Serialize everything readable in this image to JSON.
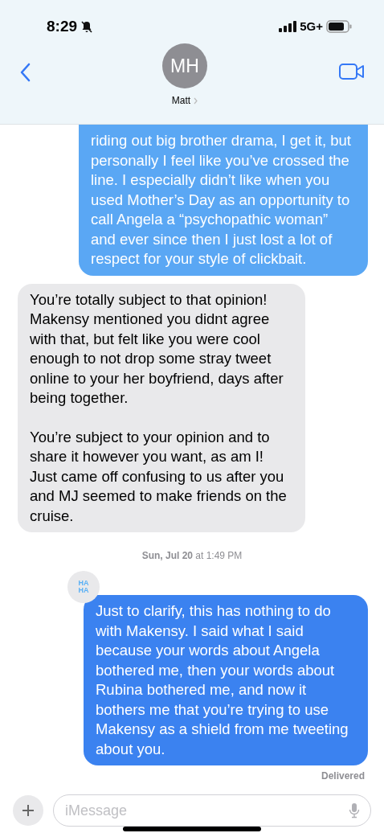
{
  "status_bar": {
    "time": "8:29",
    "network": "5G+"
  },
  "header": {
    "initials": "MH",
    "name": "Matt"
  },
  "conversation": [
    {
      "kind": "message",
      "from_me": true,
      "paragraphs": [
        "riding out big brother drama, I get it, but personally I feel like you’ve crossed the line. I especially didn’t like when you used Mother’s Day as an opportunity to call Angela a “psychopathic woman” and ever since then I just lost a lot of respect for your style of clickbait."
      ]
    },
    {
      "kind": "message",
      "from_me": false,
      "paragraphs": [
        "You’re totally subject to that opinion! Makensy mentioned you didnt agree with that, but felt like you were cool enough to not drop some stray tweet online to your her boyfriend, days after being together.",
        "You’re subject to your opinion and to share it however you want, as am I! Just came off confusing to us after you and MJ seemed to make friends on the cruise."
      ]
    },
    {
      "kind": "timestamp",
      "day": "Sun, Jul 20",
      "time": "at 1:49 PM"
    },
    {
      "kind": "message",
      "from_me": true,
      "reaction": [
        "HA",
        "HA"
      ],
      "paragraphs": [
        "Just to clarify, this has nothing to do with Makensy. I said what I said because your words about Angela bothered me, then your words about Rubina bothered me, and now it bothers me that you’re trying to use Makensy as a shield from me tweeting about you."
      ],
      "status": "Delivered"
    }
  ],
  "composer": {
    "placeholder": "iMessage"
  }
}
